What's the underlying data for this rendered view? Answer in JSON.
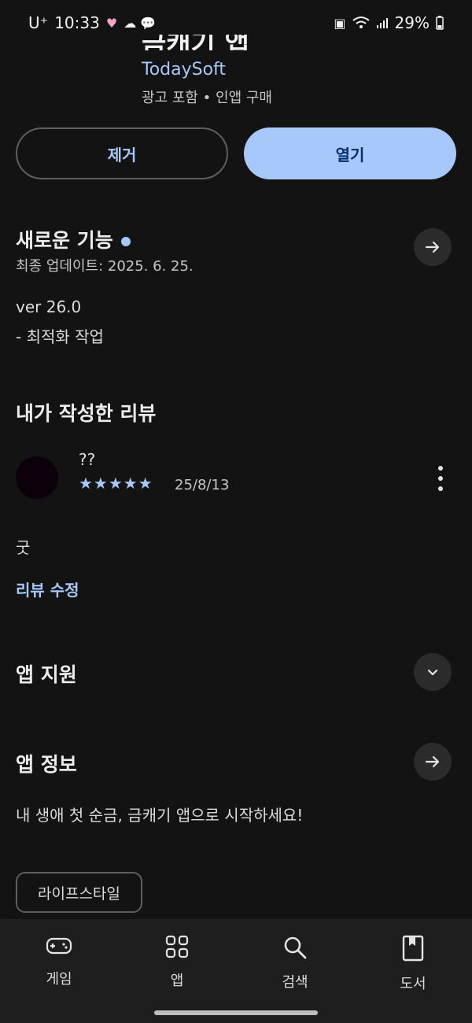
{
  "status": {
    "carrier": "U⁺",
    "time": "10:33",
    "battery": "29%"
  },
  "app": {
    "title": "금캐기 앱",
    "developer": "TodaySoft",
    "meta": "광고 포함 • 인앱 구매"
  },
  "actions": {
    "remove_label": "제거",
    "open_label": "열기"
  },
  "whats_new": {
    "title": "새로운 기능",
    "updated": "최종 업데이트: 2025. 6. 25.",
    "version": "ver 26.0",
    "note": "- 최적화 작업"
  },
  "my_review": {
    "title": "내가 작성한 리뷰",
    "reviewer": "??",
    "stars": "★★★★★",
    "rating": 5,
    "date": "25/8/13",
    "text": "굿",
    "edit_label": "리뷰 수정"
  },
  "app_support": {
    "title": "앱 지원"
  },
  "app_info": {
    "title": "앱 정보",
    "description": "내 생애 첫 순금, 금캐기 앱으로 시작하세요!",
    "category": "라이프스타일"
  },
  "nav": {
    "items": [
      {
        "label": "게임",
        "icon": "gamepad-icon"
      },
      {
        "label": "앱",
        "icon": "apps-grid-icon"
      },
      {
        "label": "검색",
        "icon": "search-icon"
      },
      {
        "label": "도서",
        "icon": "book-icon"
      }
    ]
  },
  "colors": {
    "accent": "#a8c7fa",
    "background": "#131313",
    "nav_background": "#1e1e1e"
  }
}
